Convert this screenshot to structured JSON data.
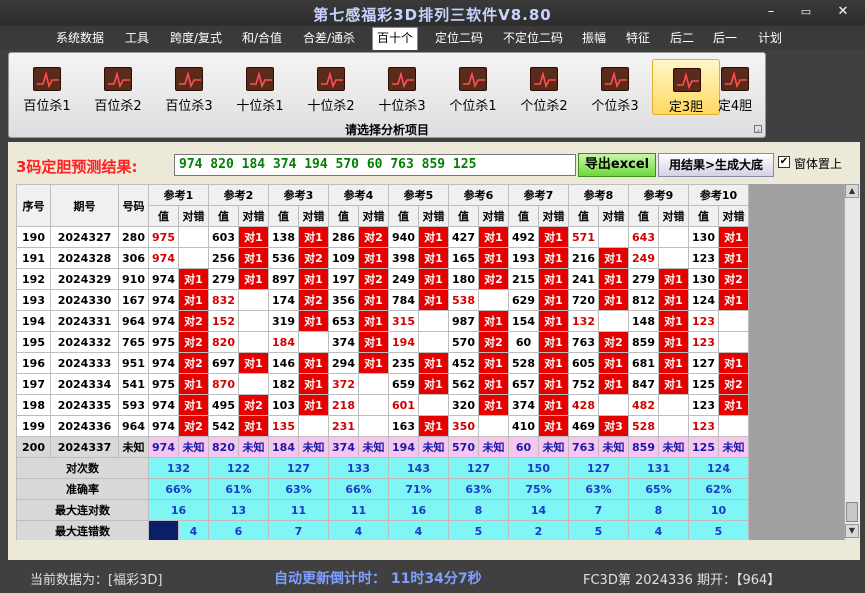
{
  "title": "第七感福彩3D排列三软件V8.80",
  "menu": [
    "系统数据",
    "工具",
    "跨度/复式",
    "和/合值",
    "合差/通杀",
    "百十个",
    "定位二码",
    "不定位二码",
    "振幅",
    "特征",
    "后二",
    "后一",
    "计划"
  ],
  "menu_active": "百十个",
  "ribbon": {
    "buttons": [
      "百位杀1",
      "百位杀2",
      "百位杀3",
      "十位杀1",
      "十位杀2",
      "十位杀3",
      "个位杀1",
      "个位杀2",
      "个位杀3",
      "定3胆",
      "定4胆"
    ],
    "active": "定3胆",
    "caption": "请选择分析项目"
  },
  "prediction": {
    "label": "3码定胆预测结果:",
    "value": "974 820 184 374 194 570 60 763 859 125",
    "export_button": "导出excel",
    "generate_button": "用结果>生成大底",
    "checkbox_label": "窗体置上",
    "checkbox_checked": true
  },
  "grid": {
    "header_row1": [
      "序号",
      "期号",
      "号码",
      "参考1",
      "参考2",
      "参考3",
      "参考4",
      "参考5",
      "参考6",
      "参考7",
      "参考8",
      "参考9",
      "参考10"
    ],
    "sub_headers": [
      "值",
      "对错"
    ],
    "rows": [
      {
        "seq": "190",
        "issue": "2024327",
        "num": "280",
        "refs": [
          [
            "975",
            ""
          ],
          [
            "603",
            "对1"
          ],
          [
            "138",
            "对1"
          ],
          [
            "286",
            "对2"
          ],
          [
            "940",
            "对1"
          ],
          [
            "427",
            "对1"
          ],
          [
            "492",
            "对1"
          ],
          [
            "571",
            ""
          ],
          [
            "643",
            ""
          ],
          [
            "130",
            "对1"
          ]
        ]
      },
      {
        "seq": "191",
        "issue": "2024328",
        "num": "306",
        "refs": [
          [
            "974",
            ""
          ],
          [
            "256",
            "对1"
          ],
          [
            "536",
            "对2"
          ],
          [
            "109",
            "对1"
          ],
          [
            "398",
            "对1"
          ],
          [
            "165",
            "对1"
          ],
          [
            "193",
            "对1"
          ],
          [
            "216",
            "对1"
          ],
          [
            "249",
            ""
          ],
          [
            "123",
            "对1"
          ]
        ]
      },
      {
        "seq": "192",
        "issue": "2024329",
        "num": "910",
        "refs": [
          [
            "974",
            "对1"
          ],
          [
            "279",
            "对1"
          ],
          [
            "897",
            "对1"
          ],
          [
            "197",
            "对2"
          ],
          [
            "249",
            "对1"
          ],
          [
            "180",
            "对2"
          ],
          [
            "215",
            "对1"
          ],
          [
            "241",
            "对1"
          ],
          [
            "279",
            "对1"
          ],
          [
            "130",
            "对2"
          ]
        ]
      },
      {
        "seq": "193",
        "issue": "2024330",
        "num": "167",
        "refs": [
          [
            "974",
            "对1"
          ],
          [
            "832",
            ""
          ],
          [
            "174",
            "对2"
          ],
          [
            "356",
            "对1"
          ],
          [
            "784",
            "对1"
          ],
          [
            "538",
            ""
          ],
          [
            "629",
            "对1"
          ],
          [
            "720",
            "对1"
          ],
          [
            "812",
            "对1"
          ],
          [
            "124",
            "对1"
          ]
        ]
      },
      {
        "seq": "194",
        "issue": "2024331",
        "num": "964",
        "refs": [
          [
            "974",
            "对2"
          ],
          [
            "152",
            ""
          ],
          [
            "319",
            "对1"
          ],
          [
            "653",
            "对1"
          ],
          [
            "315",
            ""
          ],
          [
            "987",
            "对1"
          ],
          [
            "154",
            "对1"
          ],
          [
            "132",
            ""
          ],
          [
            "148",
            "对1"
          ],
          [
            "123",
            ""
          ]
        ]
      },
      {
        "seq": "195",
        "issue": "2024332",
        "num": "765",
        "refs": [
          [
            "975",
            "对2"
          ],
          [
            "820",
            ""
          ],
          [
            "184",
            ""
          ],
          [
            "374",
            "对1"
          ],
          [
            "194",
            ""
          ],
          [
            "570",
            "对2"
          ],
          [
            "60",
            "对1"
          ],
          [
            "763",
            "对2"
          ],
          [
            "859",
            "对1"
          ],
          [
            "123",
            ""
          ]
        ]
      },
      {
        "seq": "196",
        "issue": "2024333",
        "num": "951",
        "refs": [
          [
            "974",
            "对2"
          ],
          [
            "697",
            "对1"
          ],
          [
            "146",
            "对1"
          ],
          [
            "294",
            "对1"
          ],
          [
            "235",
            "对1"
          ],
          [
            "452",
            "对1"
          ],
          [
            "528",
            "对1"
          ],
          [
            "605",
            "对1"
          ],
          [
            "681",
            "对1"
          ],
          [
            "127",
            "对1"
          ]
        ]
      },
      {
        "seq": "197",
        "issue": "2024334",
        "num": "541",
        "refs": [
          [
            "975",
            "对1"
          ],
          [
            "870",
            ""
          ],
          [
            "182",
            "对1"
          ],
          [
            "372",
            ""
          ],
          [
            "659",
            "对1"
          ],
          [
            "562",
            "对1"
          ],
          [
            "657",
            "对1"
          ],
          [
            "752",
            "对1"
          ],
          [
            "847",
            "对1"
          ],
          [
            "125",
            "对2"
          ]
        ]
      },
      {
        "seq": "198",
        "issue": "2024335",
        "num": "593",
        "refs": [
          [
            "974",
            "对1"
          ],
          [
            "495",
            "对2"
          ],
          [
            "103",
            "对1"
          ],
          [
            "218",
            ""
          ],
          [
            "601",
            ""
          ],
          [
            "320",
            "对1"
          ],
          [
            "374",
            "对1"
          ],
          [
            "428",
            ""
          ],
          [
            "482",
            ""
          ],
          [
            "123",
            "对1"
          ]
        ]
      },
      {
        "seq": "199",
        "issue": "2024336",
        "num": "964",
        "refs": [
          [
            "974",
            "对2"
          ],
          [
            "542",
            "对1"
          ],
          [
            "135",
            ""
          ],
          [
            "231",
            ""
          ],
          [
            "163",
            "对1"
          ],
          [
            "350",
            ""
          ],
          [
            "410",
            "对1"
          ],
          [
            "469",
            "对3"
          ],
          [
            "528",
            ""
          ],
          [
            "123",
            ""
          ]
        ]
      }
    ],
    "predict_row": {
      "seq": "200",
      "issue": "2024337",
      "num": "未知",
      "values": [
        "974",
        "820",
        "184",
        "374",
        "194",
        "570",
        "60",
        "763",
        "859",
        "125"
      ],
      "unknown": "未知"
    },
    "stats": [
      {
        "label": "对次数",
        "values": [
          "132",
          "122",
          "127",
          "133",
          "143",
          "127",
          "150",
          "127",
          "131",
          "124"
        ]
      },
      {
        "label": "准确率",
        "values": [
          "66%",
          "61%",
          "63%",
          "66%",
          "71%",
          "63%",
          "75%",
          "63%",
          "65%",
          "62%"
        ]
      },
      {
        "label": "最大连对数",
        "values": [
          "16",
          "13",
          "11",
          "11",
          "16",
          "8",
          "14",
          "7",
          "8",
          "10"
        ]
      },
      {
        "label": "最大连错数",
        "values": [
          "4",
          "6",
          "7",
          "4",
          "4",
          "5",
          "2",
          "5",
          "4",
          "5"
        ]
      }
    ]
  },
  "status": {
    "current_data": "当前数据为：[福彩3D]",
    "countdown": "自动更新倒计时： 11时34分7秒",
    "issue_info": "FC3D第 2024336 期开：【964】"
  },
  "colors": {
    "hit": "#e60000",
    "predict": "#f7c6f0",
    "stats": "#7ff5f5",
    "miss_value": "#d40000"
  }
}
